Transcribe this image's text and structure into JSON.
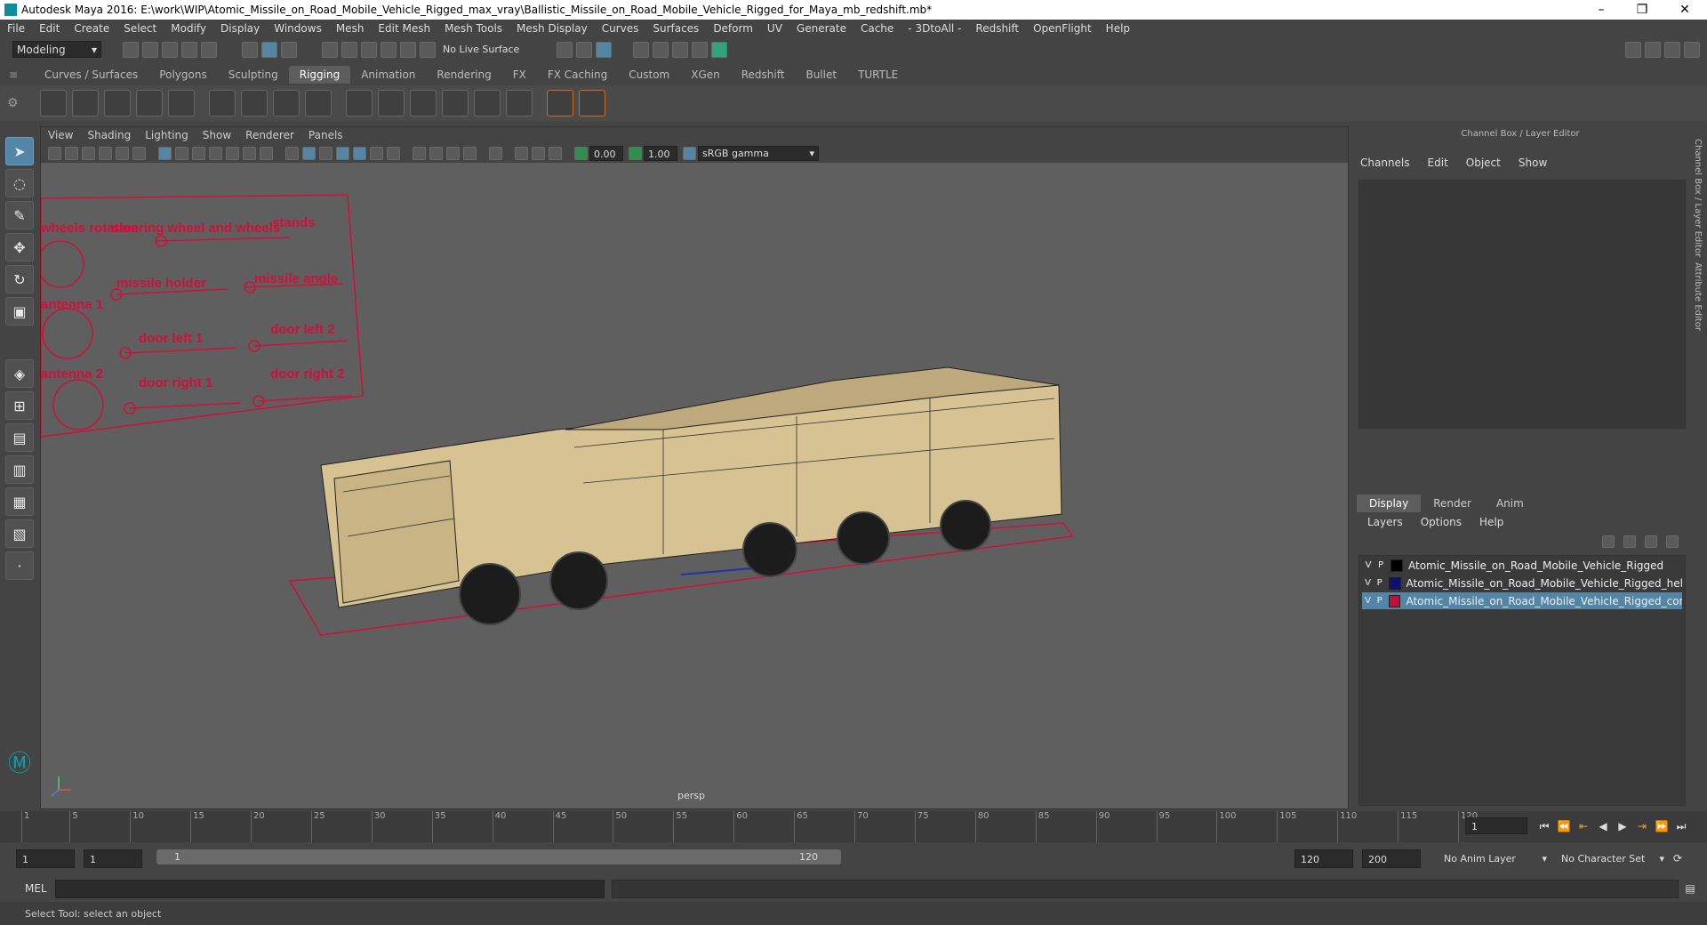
{
  "titlebar": {
    "title": "Autodesk Maya 2016: E:\\work\\WIP\\Atomic_Missile_on_Road_Mobile_Vehicle_Rigged_max_vray\\Ballistic_Missile_on_Road_Mobile_Vehicle_Rigged_for_Maya_mb_redshift.mb*",
    "minimize": "–",
    "maximize": "❐",
    "close": "✕"
  },
  "menubar": {
    "items": [
      "File",
      "Edit",
      "Create",
      "Select",
      "Modify",
      "Display",
      "Windows",
      "Mesh",
      "Edit Mesh",
      "Mesh Tools",
      "Mesh Display",
      "Curves",
      "Surfaces",
      "Deform",
      "UV",
      "Generate",
      "Cache",
      "- 3DtoAll -",
      "Redshift",
      "OpenFlight",
      "Help"
    ]
  },
  "toolbar": {
    "mode": "Modeling",
    "live_surface": "No Live Surface"
  },
  "shelf": {
    "tabs": [
      "Curves / Surfaces",
      "Polygons",
      "Sculpting",
      "Rigging",
      "Animation",
      "Rendering",
      "FX",
      "FX Caching",
      "Custom",
      "XGen",
      "Redshift",
      "Bullet",
      "TURTLE"
    ],
    "active": "Rigging"
  },
  "viewport": {
    "menu": [
      "View",
      "Shading",
      "Lighting",
      "Show",
      "Renderer",
      "Panels"
    ],
    "exposure": "0.00",
    "gamma": "1.00",
    "colorspace": "sRGB gamma",
    "camera_label": "persp",
    "rig_labels": [
      "wheels rotation",
      "steering wheel and wheels",
      "stands",
      "missile holder",
      "missile angle",
      "antenna 1",
      "door left 1",
      "door left 2",
      "antenna 2",
      "door right 1",
      "door right 2"
    ],
    "label_color": "#d0103a",
    "body_color": "#d6c293"
  },
  "channel_box": {
    "title": "Channel Box / Layer Editor",
    "menu": [
      "Channels",
      "Edit",
      "Object",
      "Show"
    ]
  },
  "layer_editor": {
    "tabs": [
      "Display",
      "Render",
      "Anim"
    ],
    "active": "Display",
    "menu": [
      "Layers",
      "Options",
      "Help"
    ],
    "layers": [
      {
        "v": "V",
        "p": "P",
        "color": "#000000",
        "name": "Atomic_Missile_on_Road_Mobile_Vehicle_Rigged",
        "selected": false
      },
      {
        "v": "V",
        "p": "P",
        "color": "#101070",
        "name": "Atomic_Missile_on_Road_Mobile_Vehicle_Rigged_helper",
        "selected": false
      },
      {
        "v": "V",
        "p": "P",
        "color": "#c01040",
        "name": "Atomic_Missile_on_Road_Mobile_Vehicle_Rigged_contro",
        "selected": true
      }
    ]
  },
  "side_tabs": [
    "Channel Box / Layer Editor",
    "Attribute Editor"
  ],
  "timeline": {
    "ticks": [
      1,
      5,
      10,
      15,
      20,
      25,
      30,
      35,
      40,
      45,
      50,
      55,
      60,
      65,
      70,
      75,
      80,
      85,
      90,
      95,
      100,
      105,
      110,
      115,
      120
    ],
    "current_frame": "1"
  },
  "range": {
    "start": "1",
    "playback_start": "1",
    "slider_start": "1",
    "slider_end": "120",
    "playback_end": "120",
    "end": "200",
    "anim_layer": "No Anim Layer",
    "character_set": "No Character Set"
  },
  "command": {
    "lang": "MEL"
  },
  "status": {
    "message": "Select Tool: select an object"
  }
}
